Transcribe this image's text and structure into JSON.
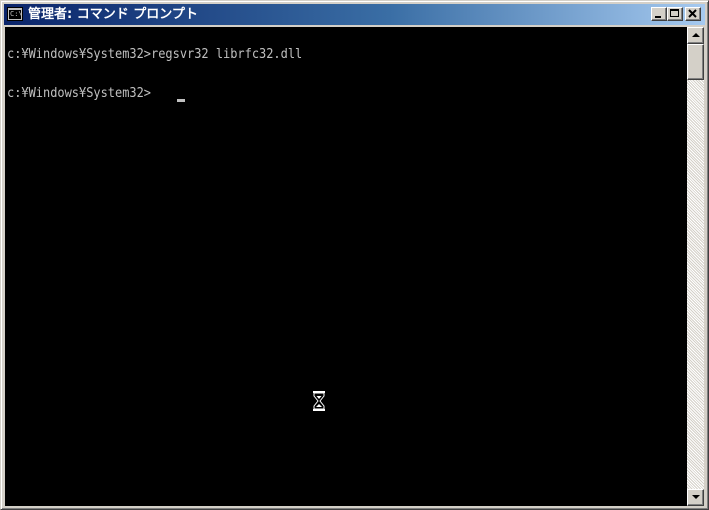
{
  "window": {
    "title": "管理者: コマンド プロンプト",
    "icon": "console-window-icon",
    "icon_text": "C:\\"
  },
  "controls": {
    "minimize": "minimize-icon",
    "maximize": "maximize-icon",
    "close": "close-icon"
  },
  "console": {
    "lines": [
      "c:¥Windows¥System32>regsvr32 librfc32.dll",
      "c:¥Windows¥System32>"
    ],
    "text_color": "#c0c0c0",
    "background": "#000000",
    "cursor_icon": "text-cursor",
    "pointer_icon": "hourglass-icon"
  },
  "scrollbar": {
    "up_icon": "arrow-up-icon",
    "down_icon": "arrow-down-icon"
  }
}
